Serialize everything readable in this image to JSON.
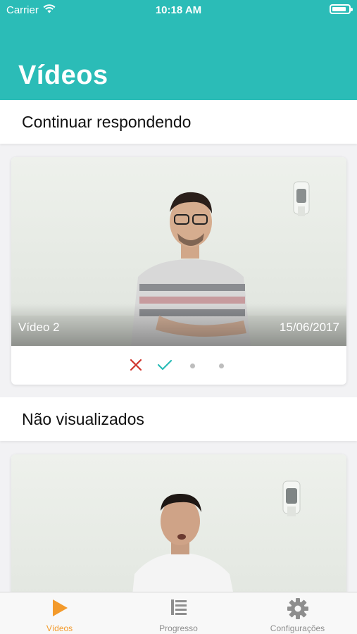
{
  "status_bar": {
    "carrier": "Carrier",
    "time": "10:18 AM"
  },
  "header": {
    "title": "Vídeos"
  },
  "sections": {
    "continue": {
      "title": "Continuar respondendo"
    },
    "unseen": {
      "title": "Não visualizados"
    }
  },
  "continue_card": {
    "video_title": "Vídeo 2",
    "date": "15/06/2017",
    "progress_steps": [
      "wrong",
      "correct",
      "pending",
      "pending"
    ]
  },
  "tabbar": {
    "items": [
      {
        "label": "Vídeos",
        "icon": "play-icon",
        "active": true
      },
      {
        "label": "Progresso",
        "icon": "list-icon",
        "active": false
      },
      {
        "label": "Configurações",
        "icon": "gear-icon",
        "active": false
      }
    ]
  },
  "colors": {
    "accent": "#2bbcb7",
    "tab_active": "#f39a2b",
    "wrong": "#d0342c",
    "correct": "#2bbcb7"
  }
}
